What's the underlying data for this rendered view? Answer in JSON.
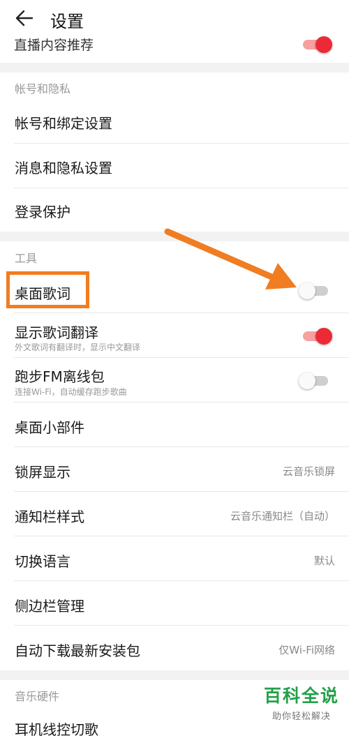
{
  "header": {
    "title": "设置"
  },
  "top_partial": {
    "label": "直播内容推荐"
  },
  "account_section": {
    "title": "帐号和隐私",
    "items": [
      {
        "label": "帐号和绑定设置"
      },
      {
        "label": "消息和隐私设置"
      },
      {
        "label": "登录保护"
      }
    ]
  },
  "tools_section": {
    "title": "工具",
    "desktop_lyrics": {
      "label": "桌面歌词",
      "on": false
    },
    "lyric_translation": {
      "label": "显示歌词翻译",
      "sub": "外文歌词有翻译时，显示中文翻译",
      "on": true
    },
    "fm_offline": {
      "label": "跑步FM离线包",
      "sub": "连接Wi-Fi，自动缓存跑步歌曲",
      "on": false
    },
    "widget": {
      "label": "桌面小部件"
    },
    "lockscreen": {
      "label": "锁屏显示",
      "value": "云音乐锁屏"
    },
    "notification": {
      "label": "通知栏样式",
      "value": "云音乐通知栏（自动）"
    },
    "language": {
      "label": "切换语言",
      "value": "默认"
    },
    "sidebar": {
      "label": "侧边栏管理"
    },
    "autodownload": {
      "label": "自动下载最新安装包",
      "value": "仅Wi-Fi网络"
    }
  },
  "hardware_section": {
    "title": "音乐硬件",
    "partial_item": {
      "label": "耳机线控切歌"
    }
  },
  "watermark": {
    "title": "百科全说",
    "sub": "助你轻松解决"
  },
  "colors": {
    "accent": "#ec2a35",
    "highlight": "#f07d22",
    "watermark": "#22a04a"
  }
}
